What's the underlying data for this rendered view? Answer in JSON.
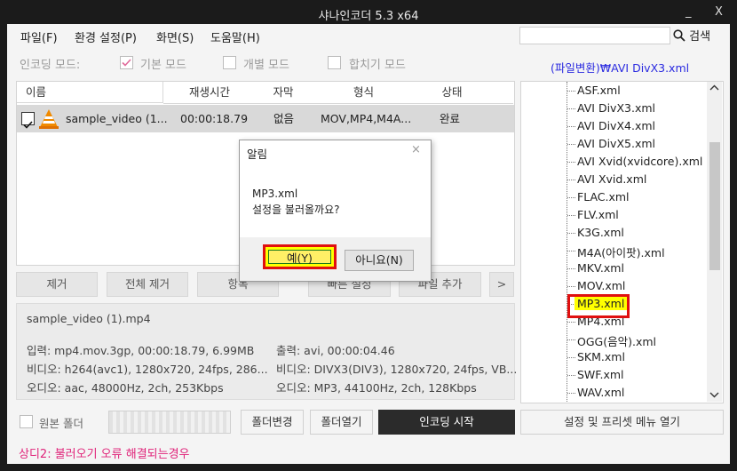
{
  "window": {
    "title": "샤나인코더  5.3  x64",
    "minimize": "_",
    "close": "X"
  },
  "menu": [
    {
      "label": "파일(F)"
    },
    {
      "label": "환경 설정(P)"
    },
    {
      "label": "화면(S)"
    },
    {
      "label": "도움말(H)"
    }
  ],
  "search": {
    "value": "",
    "button": "검색"
  },
  "modes": {
    "label": "인코딩 모드:",
    "basic": {
      "label": "기본 모드",
      "checked": true
    },
    "individual": {
      "label": "개별 모드",
      "checked": false
    },
    "merge": {
      "label": "합치기 모드",
      "checked": false
    }
  },
  "preset_path": "(파일변환)₩AVI DivX3.xml",
  "table": {
    "headers": [
      "이름",
      "재생시간",
      "자막",
      "형식",
      "상태"
    ],
    "rows": [
      {
        "checked": true,
        "name": "sample_video (1...",
        "duration": "00:00:18.79",
        "subtitle": "없음",
        "format": "MOV,MP4,M4A...",
        "status": "완료"
      }
    ]
  },
  "actions": {
    "remove": "제거",
    "remove_all": "전체 제거",
    "item": "항목",
    "quick_settings": "빠른 설정",
    "add_file": "파일 추가",
    "more": ">"
  },
  "info": {
    "filename": "sample_video (1).mp4",
    "input": "입력: mp4.mov.3gp, 00:00:18.79, 6.99MB",
    "video_in": "비디오: h264(avc1), 1280x720, 24fps, 286...",
    "audio_in": "오디오: aac, 48000Hz, 2ch, 253Kbps",
    "output": "출력: avi, 00:00:04.46",
    "video_out": "비디오: DIVX3(DIV3), 1280x720, 24fps, VB...",
    "audio_out": "오디오: MP3, 44100Hz, 2ch, 128Kbps"
  },
  "presets": [
    "ASF.xml",
    "AVI DivX3.xml",
    "AVI DivX4.xml",
    "AVI DivX5.xml",
    "AVI Xvid(xvidcore).xml",
    "AVI Xvid.xml",
    "FLAC.xml",
    "FLV.xml",
    "K3G.xml",
    "M4A(아이팟).xml",
    "MKV.xml",
    "MOV.xml",
    "MP3.xml",
    "MP4.xml",
    "OGG(음악).xml",
    "SKM.xml",
    "SWF.xml",
    "WAV.xml"
  ],
  "selected_preset": "MP3.xml",
  "bottom": {
    "source_folder": "원본 폴더",
    "folder_path": "",
    "change_folder": "폴더변경",
    "open_folder": "폴더열기",
    "start": "인코딩 시작",
    "settings_menu": "설정 및 프리셋 메뉴 열기"
  },
  "dialog": {
    "title": "알림",
    "close": "×",
    "line1": "MP3.xml",
    "line2": "설정을 불러올까요?",
    "yes": "예(Y)",
    "no": "아니요(N)"
  },
  "caption": "상디2: 불러오기 오류 해결되는경우",
  "colors": {
    "highlight_border": "#e01010",
    "highlight_fill": "#ffff00",
    "caption": "#e0247a",
    "link": "#2a2ae0",
    "start_button": "#2b2b2b"
  }
}
